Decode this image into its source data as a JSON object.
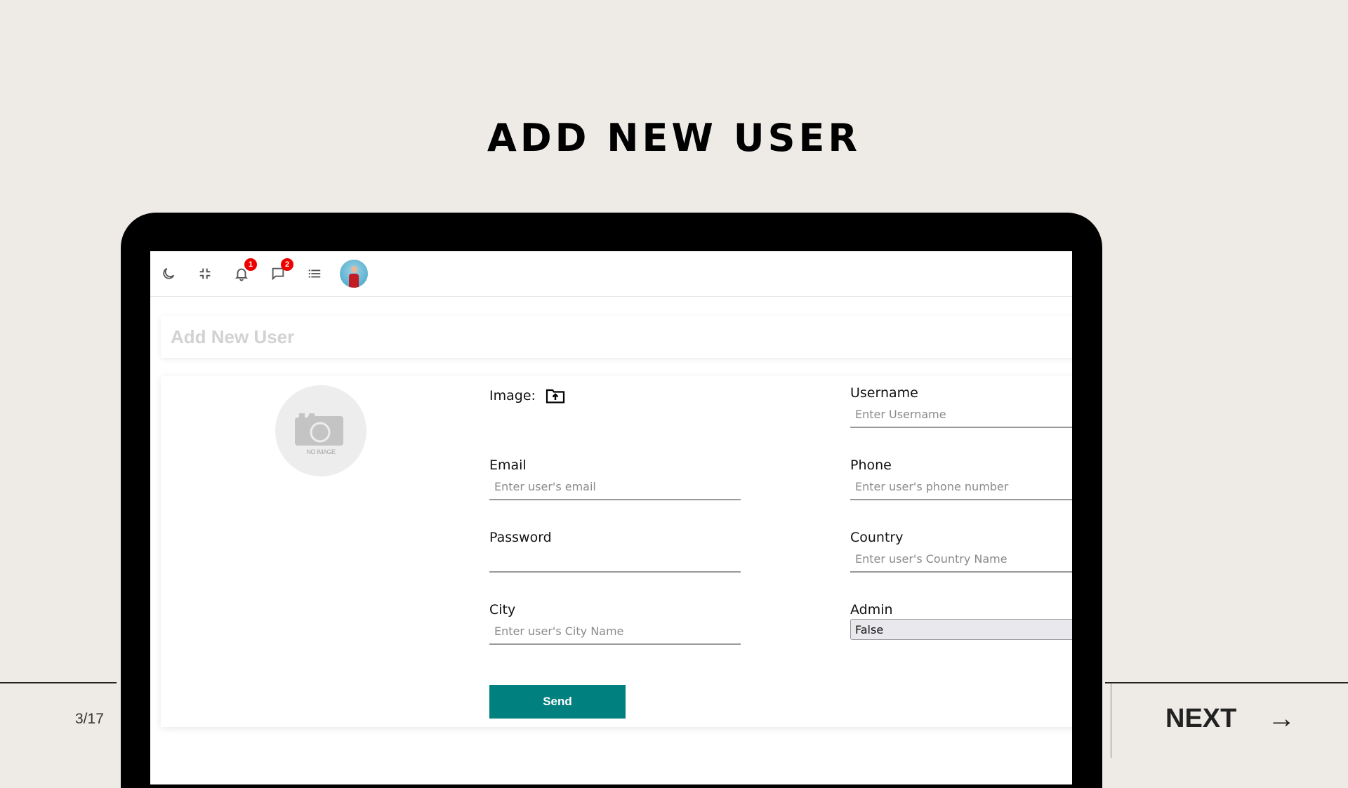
{
  "slide": {
    "title": "ADD NEW USER",
    "page_indicator": "3/17",
    "next_label": "NEXT",
    "next_arrow": "→"
  },
  "topbar": {
    "icons": [
      {
        "name": "dark-mode-moon-icon"
      },
      {
        "name": "fullscreen-exit-icon"
      },
      {
        "name": "notifications-bell-icon",
        "badge": "1"
      },
      {
        "name": "chat-bubble-icon",
        "badge": "2"
      },
      {
        "name": "list-icon"
      },
      {
        "name": "user-avatar"
      }
    ]
  },
  "page_header": {
    "title": "Add New User"
  },
  "form": {
    "image_placeholder_text": "NO IMAGE",
    "image_label": "Image:",
    "fields": {
      "username": {
        "label": "Username",
        "placeholder": "Enter Username",
        "value": ""
      },
      "email": {
        "label": "Email",
        "placeholder": "Enter user's email",
        "value": ""
      },
      "phone": {
        "label": "Phone",
        "placeholder": "Enter user's phone number",
        "value": ""
      },
      "password": {
        "label": "Password",
        "placeholder": "",
        "value": ""
      },
      "country": {
        "label": "Country",
        "placeholder": "Enter user's Country Name",
        "value": ""
      },
      "city": {
        "label": "City",
        "placeholder": "Enter user's City Name",
        "value": ""
      },
      "admin": {
        "label": "Admin",
        "selected": "False"
      }
    },
    "submit_label": "Send"
  },
  "colors": {
    "background": "#eeeae6",
    "accent": "#00807f",
    "badge": "#ee0000"
  }
}
